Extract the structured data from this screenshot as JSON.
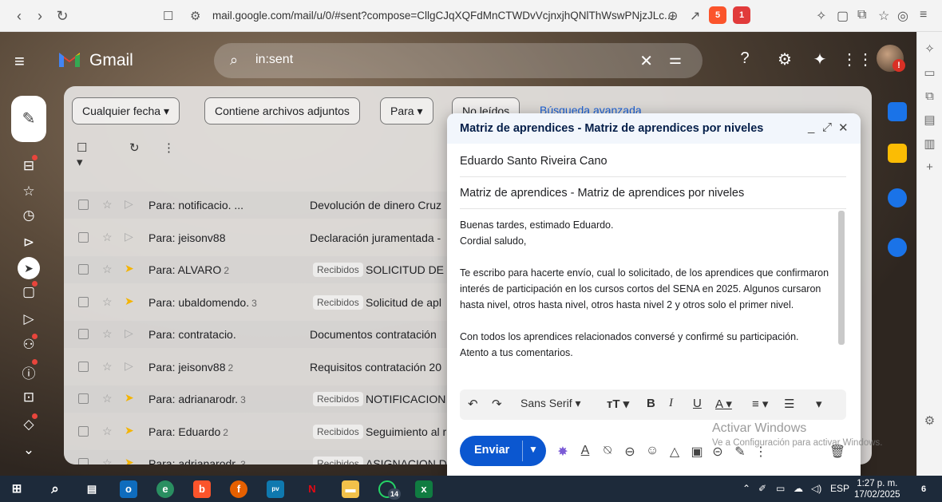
{
  "browser": {
    "url": "mail.google.com/mail/u/0/#sent?compose=CllgCJqXQFdMnCTWDvVcjnxjhQNlThWswPNjzJLc...",
    "brave_badge": "5",
    "alert_badge": "1"
  },
  "gmail": {
    "app_name": "Gmail",
    "search_query": "in:sent",
    "avatar_badge": "!"
  },
  "filters": {
    "any_date": "Cualquier fecha ▾",
    "has_attachments": "Contiene archivos adjuntos",
    "to": "Para ▾",
    "unread": "No leídos",
    "advanced_search": "Búsqueda avanzada"
  },
  "emails": [
    {
      "to": "Para: notificacio. ...",
      "count": "",
      "label": "",
      "subject": "Devolución de dinero Cruz",
      "important": false
    },
    {
      "to": "Para: jeisonv88",
      "count": "",
      "label": "",
      "subject": "Declaración juramentada -",
      "important": false
    },
    {
      "to": "Para: ALVARO",
      "count": "2",
      "label": "Recibidos",
      "subject": "SOLICITUD DE F",
      "important": true
    },
    {
      "to": "Para: ubaldomendo.",
      "count": "3",
      "label": "Recibidos",
      "subject": "Solicitud de apl",
      "important": true
    },
    {
      "to": "Para: contratacio.",
      "count": "",
      "label": "",
      "subject": "Documentos contratación",
      "important": false
    },
    {
      "to": "Para: jeisonv88",
      "count": "2",
      "label": "",
      "subject": "Requisitos contratación 20",
      "important": false
    },
    {
      "to": "Para: adrianarodr.",
      "count": "3",
      "label": "Recibidos",
      "subject": "NOTIFICACION /",
      "important": true
    },
    {
      "to": "Para: Eduardo",
      "count": "2",
      "label": "Recibidos",
      "subject": "Seguimiento al r",
      "important": true
    },
    {
      "to": "Para: adrianarodr.",
      "count": "3",
      "label": "Recibidos",
      "subject": "ASIGNACION DE",
      "important": true
    }
  ],
  "compose": {
    "title": "Matriz de aprendices - Matriz de aprendices por niveles",
    "recipient": "Eduardo Santo Riveira Cano",
    "subject": "Matriz de aprendices - Matriz de aprendices por niveles",
    "body": [
      "Buenas tardes, estimado Eduardo.",
      "Cordial saludo,",
      "",
      "Te escribo para hacerte envío, cual lo solicitado, de los aprendices que confirmaron interés de participación en los cursos cortos del SENA en 2025. Algunos cursaron hasta nivel, otros hasta nivel, otros hasta nivel 2 y otros solo el primer nivel.",
      "",
      "Con todos los aprendices relacionados conversé y confirmé su participación.",
      "Atento a tus comentarios."
    ],
    "font": "Sans Serif",
    "send_label": "Enviar"
  },
  "watermark": {
    "title": "Activar Windows",
    "subtitle": "Ve a Configuración para activar Windows."
  },
  "taskbar": {
    "whatsapp_badge": "14",
    "lang": "ESP",
    "time": "1:27 p. m.",
    "date": "17/02/2025",
    "notif_count": "6"
  }
}
